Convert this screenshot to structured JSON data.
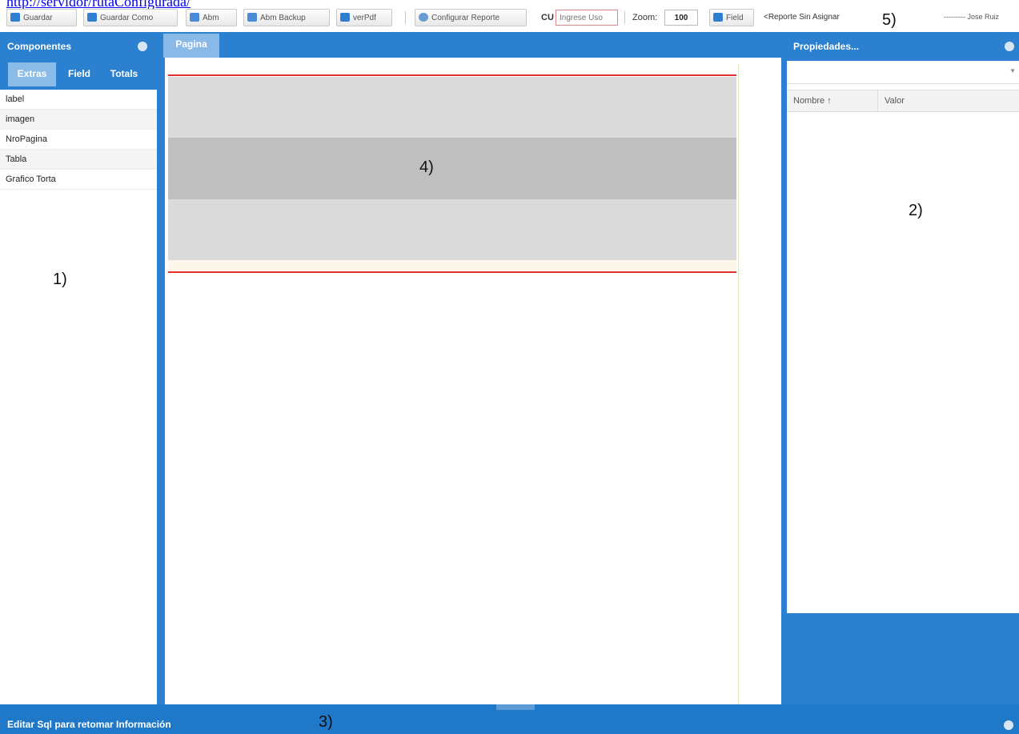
{
  "top_link": "http://servidor/rutaConfigurada/",
  "toolbar": {
    "guardar": "Guardar",
    "guardar_como": "Guardar Como",
    "abm": "Abm",
    "abm_backup": "Abm Backup",
    "ver_pdf": "verPdf",
    "configurar_reporte": "Configurar Reporte",
    "cu_label": "CU",
    "cu_placeholder": "Ingrese Uso",
    "zoom_label": "Zoom:",
    "zoom_value": "100",
    "field": "Field",
    "reporte_status": "<Reporte Sin Asignar",
    "user": "--------- Jose Ruiz"
  },
  "left_panel": {
    "title": "Componentes",
    "tabs": [
      "Extras",
      "Field",
      "Totals"
    ],
    "active_tab": 0,
    "items": [
      "label",
      "imagen",
      "NroPagina",
      "Tabla",
      "Grafico Torta"
    ]
  },
  "center": {
    "tab": "Pagina"
  },
  "right_panel": {
    "title": "Propiedades...",
    "columns": [
      "Nombre ↑",
      "Valor"
    ]
  },
  "bottom": {
    "title": "Editar Sql para retomar Información"
  },
  "annotations": [
    "1)",
    "2)",
    "3)",
    "4)",
    "5)"
  ],
  "colors": {
    "panel_blue": "#2b81cf",
    "active_tab": "#8bbbe7",
    "band_light": "#dadada",
    "band_dark": "#bfbfbf",
    "guide_line": "#e53030"
  }
}
